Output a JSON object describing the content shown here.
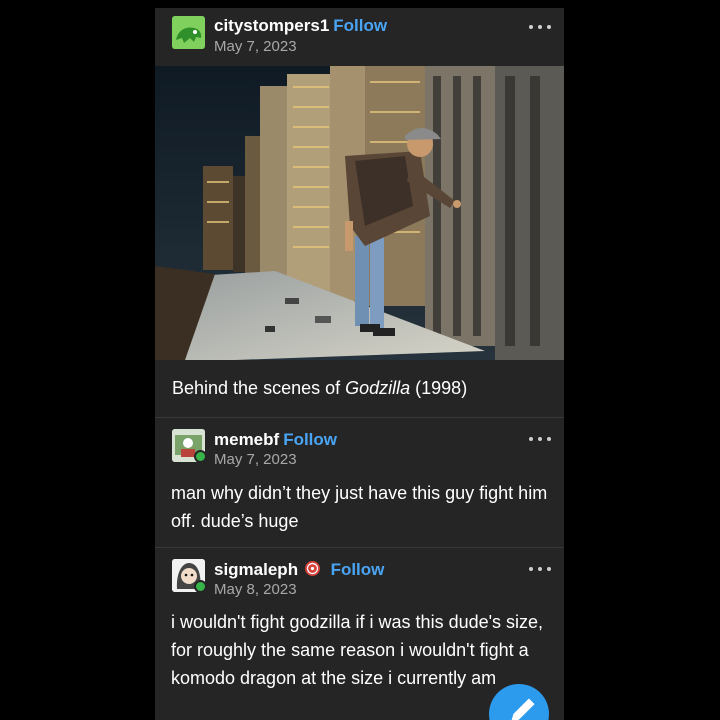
{
  "post": {
    "author": "citystompers1",
    "follow_label": "Follow",
    "date": "May 7, 2023",
    "caption_prefix": "Behind the scenes of ",
    "caption_title": "Godzilla",
    "caption_suffix": " (1998)"
  },
  "comments": [
    {
      "author": "memebf",
      "follow_label": "Follow",
      "date": "May 7, 2023",
      "text": "man why didn’t they just have this guy fight him off. dude’s huge"
    },
    {
      "author": "sigmaleph",
      "follow_label": "Follow",
      "date": "May 8, 2023",
      "text": "i wouldn't fight godzilla if i was this dude's size, for roughly the same reason i wouldn't fight a komodo dragon at the size i currently am"
    }
  ],
  "icons": {
    "more": "more-options-icon",
    "edit": "pencil-icon",
    "badge": "badge-icon"
  },
  "colors": {
    "background": "#000000",
    "card": "#252525",
    "follow": "#4aa4f4",
    "date": "#a8a8a8",
    "fab": "#2c9bee",
    "status_dot": "#38b54a"
  }
}
